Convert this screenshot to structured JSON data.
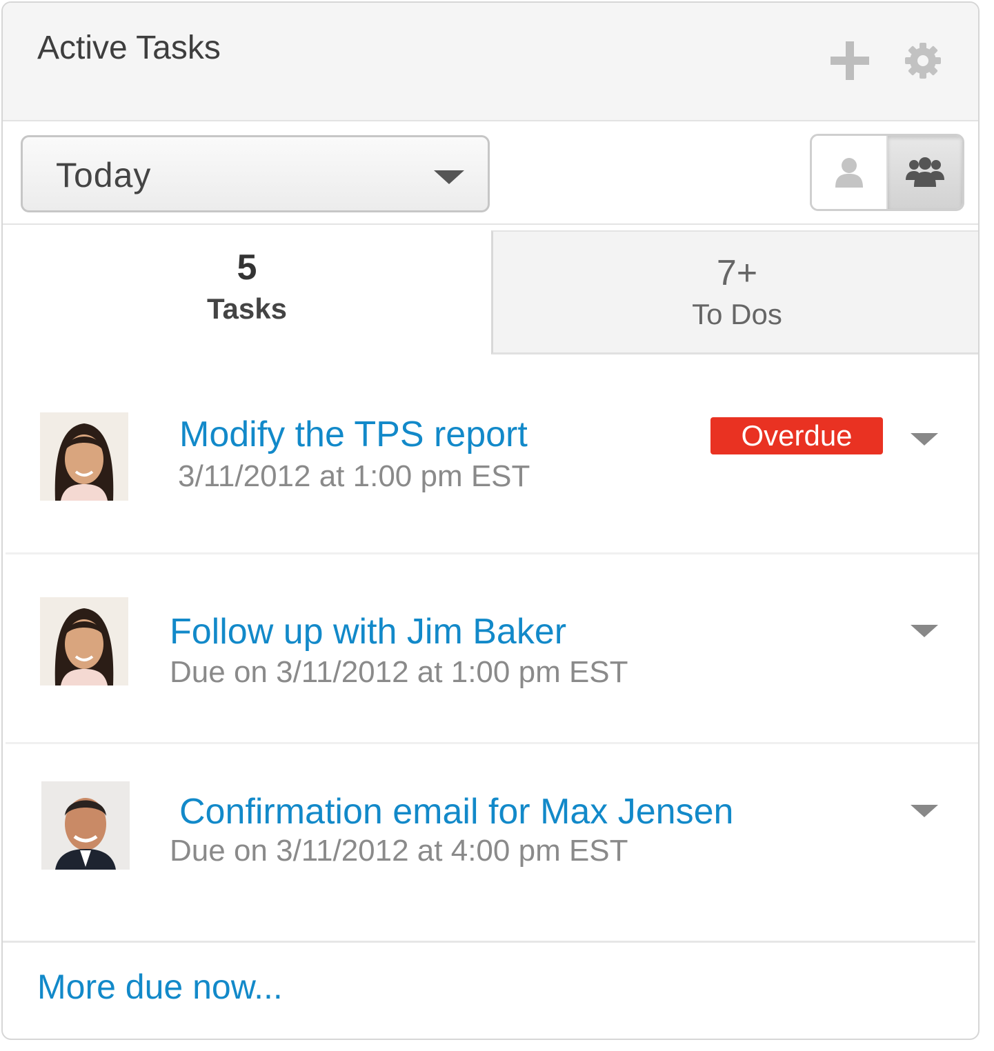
{
  "header": {
    "title": "Active Tasks",
    "add_icon": "plus-icon",
    "settings_icon": "gear-icon"
  },
  "filter": {
    "selected": "Today",
    "view_toggle": {
      "options": [
        "me",
        "team"
      ],
      "active": "team",
      "icons": [
        "single-person-icon",
        "group-icon"
      ]
    }
  },
  "tabs": [
    {
      "count": "5",
      "label": "Tasks",
      "active": true
    },
    {
      "count": "7+",
      "label": "To Dos",
      "active": false
    }
  ],
  "tasks": [
    {
      "title": "Modify the TPS report",
      "due": "3/11/2012 at 1:00 pm EST",
      "badge": "Overdue",
      "avatar": "woman-avatar"
    },
    {
      "title": "Follow up with Jim Baker",
      "due": "Due on 3/11/2012 at 1:00 pm EST",
      "badge": null,
      "avatar": "woman-avatar"
    },
    {
      "title": "Confirmation email for Max Jensen",
      "due": "Due on 3/11/2012 at 4:00 pm EST",
      "badge": null,
      "avatar": "man-avatar"
    }
  ],
  "footer": {
    "more_link": "More due now..."
  },
  "colors": {
    "link": "#1289c9",
    "overdue": "#e93222",
    "muted": "#8a8a8a"
  }
}
